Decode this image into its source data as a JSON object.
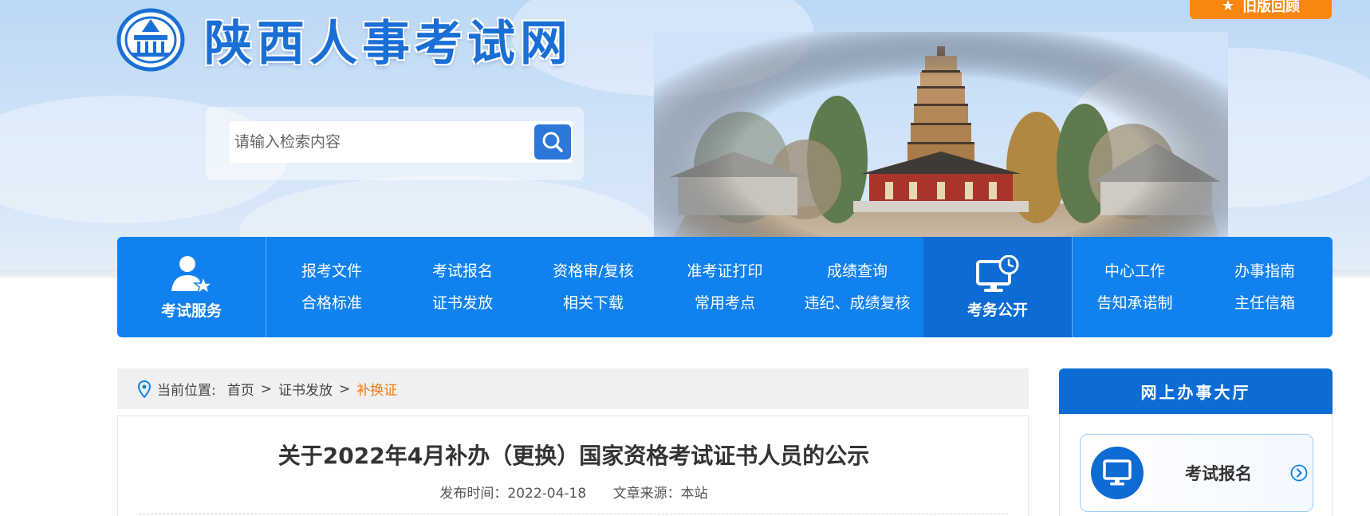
{
  "site": {
    "title": "陕西人事考试网",
    "old_version_label": "旧版回顾"
  },
  "search": {
    "placeholder": "请输入检索内容"
  },
  "nav": {
    "exam_service": {
      "label": "考试服务",
      "links": [
        "报考文件",
        "考试报名",
        "资格审/复核",
        "准考证打印",
        "成绩查询",
        "合格标准",
        "证书发放",
        "相关下载",
        "常用考点",
        "违纪、成绩复核"
      ]
    },
    "exam_affairs": {
      "label": "考务公开",
      "links": [
        "中心工作",
        "办事指南",
        "告知承诺制",
        "主任信箱"
      ]
    }
  },
  "breadcrumb": {
    "prefix": "当前位置:",
    "items": [
      "首页",
      "证书发放",
      "补换证"
    ],
    "separator": ">"
  },
  "article": {
    "title": "关于2022年4月补办（更换）国家资格考试证书人员的公示",
    "publish_time": "发布时间：2022-04-18",
    "source": "文章来源：本站"
  },
  "sidebar": {
    "title": "网上办事大厅",
    "card_label": "考试报名"
  },
  "colors": {
    "nav_blue": "#1181f0",
    "nav_dark_blue": "#0d6cd4",
    "accent_orange": "#f07a12",
    "button_orange": "#f7870f"
  }
}
